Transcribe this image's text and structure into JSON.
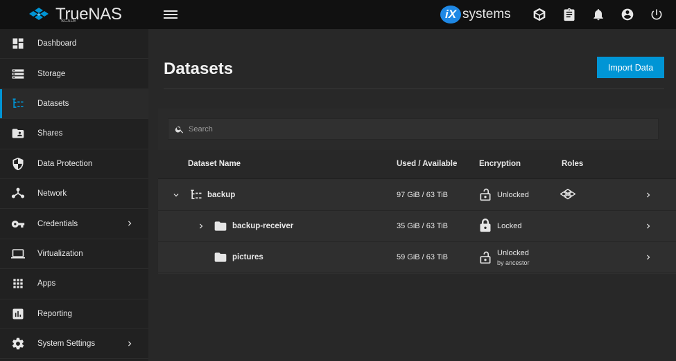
{
  "brand": {
    "name": "TrueNAS",
    "edition": "SCALE",
    "vendor_badge": "iX",
    "vendor_text": "systems"
  },
  "colors": {
    "accent": "#0095d5",
    "topbar": "#111111",
    "sidebar": "#212121",
    "content": "#282828"
  },
  "topbar": {
    "icons": [
      "truecommand-icon",
      "clipboard-icon",
      "bell-icon",
      "account-circle-icon",
      "power-icon"
    ]
  },
  "sidebar": {
    "items": [
      {
        "label": "Dashboard",
        "icon": "dashboard-icon",
        "active": false,
        "has_children": false
      },
      {
        "label": "Storage",
        "icon": "storage-icon",
        "active": false,
        "has_children": false
      },
      {
        "label": "Datasets",
        "icon": "datasets-icon",
        "active": true,
        "has_children": false
      },
      {
        "label": "Shares",
        "icon": "shares-icon",
        "active": false,
        "has_children": false
      },
      {
        "label": "Data Protection",
        "icon": "shield-icon",
        "active": false,
        "has_children": false
      },
      {
        "label": "Network",
        "icon": "network-icon",
        "active": false,
        "has_children": false
      },
      {
        "label": "Credentials",
        "icon": "key-icon",
        "active": false,
        "has_children": true
      },
      {
        "label": "Virtualization",
        "icon": "laptop-icon",
        "active": false,
        "has_children": false
      },
      {
        "label": "Apps",
        "icon": "apps-grid-icon",
        "active": false,
        "has_children": false
      },
      {
        "label": "Reporting",
        "icon": "chart-icon",
        "active": false,
        "has_children": false
      },
      {
        "label": "System Settings",
        "icon": "gear-icon",
        "active": false,
        "has_children": true
      }
    ]
  },
  "page": {
    "title": "Datasets",
    "import_button": "Import Data"
  },
  "search": {
    "placeholder": "Search",
    "value": ""
  },
  "table": {
    "columns": {
      "name": "Dataset Name",
      "used": "Used / Available",
      "encryption": "Encryption",
      "roles": "Roles"
    },
    "rows": [
      {
        "name": "backup",
        "used": "97 GiB / 63 TiB",
        "encryption": "Unlocked",
        "encryption_sub": "",
        "lock": "unlocked",
        "expanded": true,
        "level": 0,
        "icon": "pool-tree-icon",
        "roles_icon": "truenas-logo-icon"
      },
      {
        "name": "backup-receiver",
        "used": "35 GiB / 63 TiB",
        "encryption": "Locked",
        "encryption_sub": "",
        "lock": "locked",
        "expanded": false,
        "level": 1,
        "icon": "folder-icon",
        "roles_icon": ""
      },
      {
        "name": "pictures",
        "used": "59 GiB / 63 TiB",
        "encryption": "Unlocked",
        "encryption_sub": "by ancestor",
        "lock": "unlocked",
        "expanded": false,
        "level": 1,
        "icon": "folder-icon",
        "roles_icon": ""
      }
    ]
  }
}
